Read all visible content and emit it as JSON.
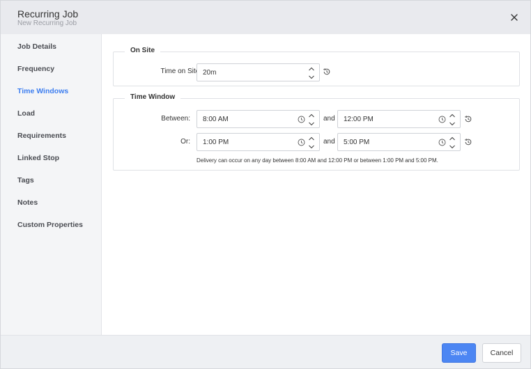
{
  "header": {
    "title": "Recurring Job",
    "subtitle": "New Recurring Job"
  },
  "sidebar": {
    "items": [
      {
        "label": "Job Details"
      },
      {
        "label": "Frequency"
      },
      {
        "label": "Time Windows",
        "active": true
      },
      {
        "label": "Load"
      },
      {
        "label": "Requirements"
      },
      {
        "label": "Linked Stop"
      },
      {
        "label": "Tags"
      },
      {
        "label": "Notes"
      },
      {
        "label": "Custom Properties"
      }
    ]
  },
  "on_site": {
    "legend": "On Site",
    "time_label": "Time on Site:",
    "time_value": "20m"
  },
  "time_window": {
    "legend": "Time Window",
    "between_label": "Between:",
    "or_label": "Or:",
    "and_label": "and",
    "window1_start": "8:00 AM",
    "window1_end": "12:00 PM",
    "window2_start": "1:00 PM",
    "window2_end": "5:00 PM",
    "note": "Delivery can occur on any day between 8:00 AM and 12:00 PM or between 1:00 PM and 5:00 PM."
  },
  "footer": {
    "save_label": "Save",
    "cancel_label": "Cancel"
  },
  "colors": {
    "accent": "#3d7ef0",
    "primary_button": "#4c86f3"
  }
}
